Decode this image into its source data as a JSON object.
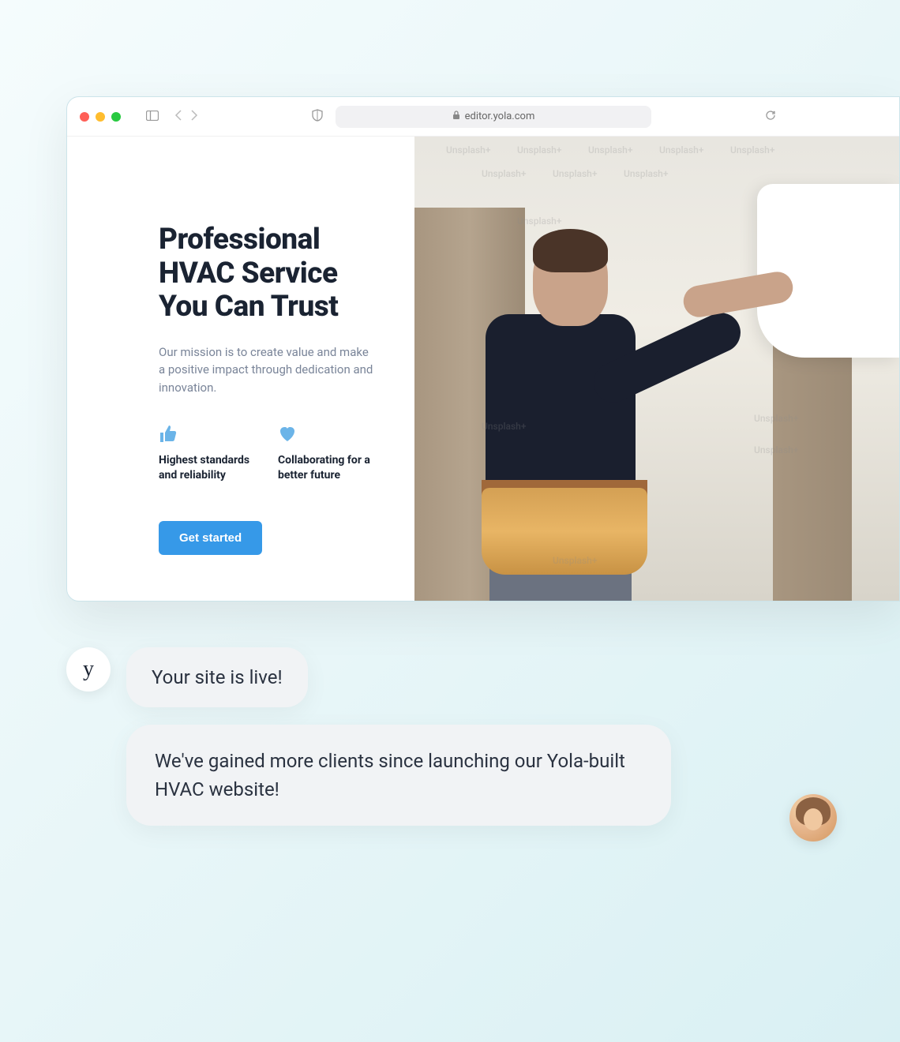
{
  "browser": {
    "url": "editor.yola.com"
  },
  "hero": {
    "title": "Professional HVAC Service You Can Trust",
    "description": "Our mission is to create value and make a positive impact through dedication and innovation.",
    "cta_label": "Get started"
  },
  "features": [
    {
      "text": "Highest standards and reliability"
    },
    {
      "text": "Collaborating for a better future"
    }
  ],
  "watermark": "Unsplash+",
  "chat": {
    "yola_label": "y",
    "message1": "Your site is live!",
    "message2": "We've gained more clients since launching our Yola-built HVAC website!"
  },
  "colors": {
    "accent": "#3699e8",
    "icon": "#6bb4e8"
  }
}
